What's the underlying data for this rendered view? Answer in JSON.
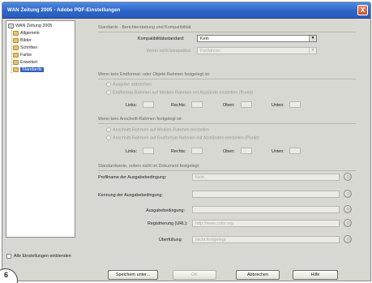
{
  "window": {
    "title": "WAN Zeitung 2005 - Adobe PDF-Einstellungen",
    "close_glyph": "X"
  },
  "tree": {
    "root": "WAN Zeitung 2005",
    "items": [
      {
        "label": "Allgemein"
      },
      {
        "label": "Bilder"
      },
      {
        "label": "Schriften"
      },
      {
        "label": "Farbe"
      },
      {
        "label": "Erweitert"
      },
      {
        "label": "Standards",
        "selected": true
      }
    ]
  },
  "alle_einstellungen": {
    "label": "Alle Einstellungen einblenden",
    "checked": false
  },
  "standards": {
    "section_title": "Standards - Berichterstattung und Kompatibilität",
    "kompat_label": "Kompatibilitätsstandard:",
    "kompat_value": "Kein",
    "nicht_kompat_label": "Wenn nicht kompatibel:",
    "nicht_kompat_value": "Fortfahren"
  },
  "trimbox": {
    "section_title": "Wenn kein Endformat- oder Objekt-Rahmen festgelegt ist:",
    "opt1": "Ausgabe abbrechen",
    "opt2": "Endformat-Rahmen auf Medien-Rahmen mit Abstände einstellen (Punkt)",
    "links": "Links:",
    "rechts": "Rechts:",
    "oben": "Oben:",
    "unten": "Unten:"
  },
  "bleedbox": {
    "section_title": "Wenn kein Anschnitt-Rahmen festgelegt ist:",
    "opt1": "Anschnitt-Rahmen auf Medien-Rahmen einstellen",
    "opt2": "Anschnitt-Rahmen auf Endformat-Rahmen mit Abständen einstellen (Punkt)",
    "links": "Links:",
    "rechts": "Rechts:",
    "oben": "Oben:",
    "unten": "Unten:"
  },
  "output_intent": {
    "section_title": "Standardwerte, sofern nicht im Dokument festgelegt:",
    "profil_label": "Profilname der Ausgabebedingung:",
    "profil_value": "Kein",
    "kennung_label": "Kennung der Ausgabebedingung:",
    "bedingung_label": "Ausgabebedingung:",
    "registrierung_label": "Registrierung (URL):",
    "registrierung_value": "http://www.color.org",
    "ueberfuellung_label": "Überfüllung:",
    "ueberfuellung_value": "Nicht festgelegt"
  },
  "buttons": {
    "save_as": "Speichern unter...",
    "ok": "OK",
    "cancel": "Abbrechen",
    "help": "Hilfe"
  },
  "page_number": "6",
  "colors": {
    "titlebar": "#2e65c8",
    "selection": "#2f5fbf",
    "dialog_bg": "#d8d8d2"
  }
}
